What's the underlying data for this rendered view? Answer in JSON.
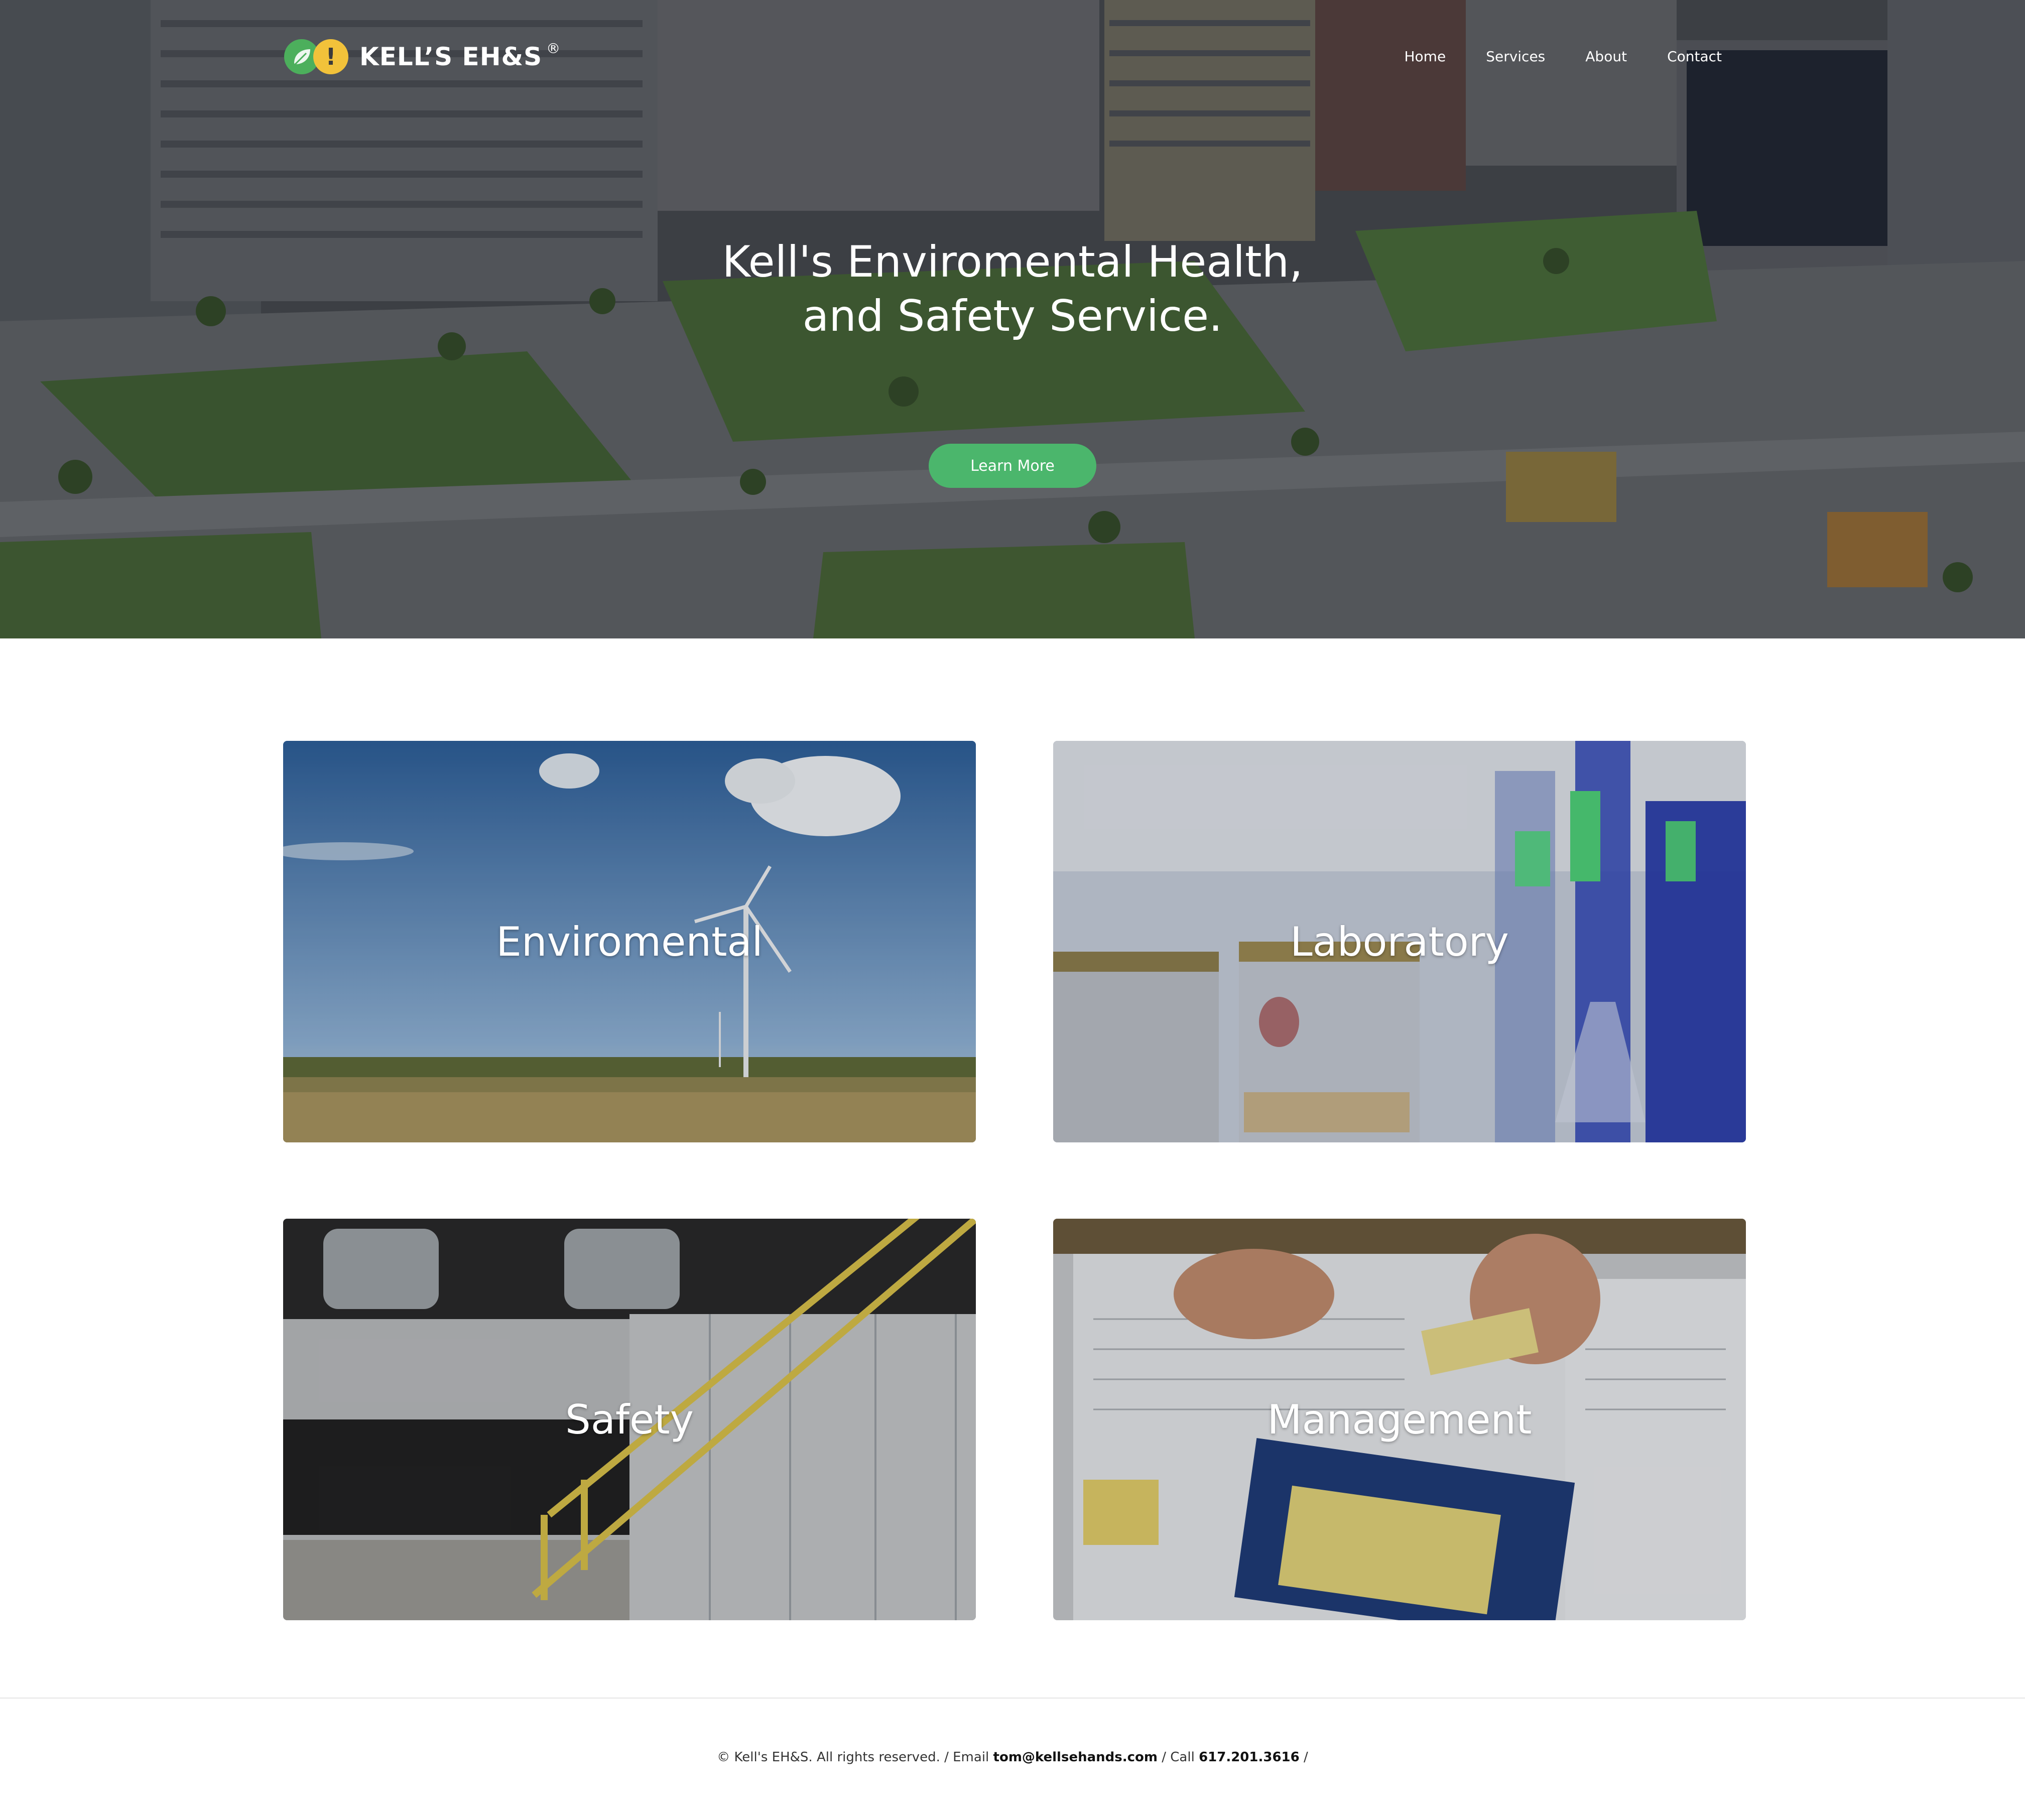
{
  "header": {
    "logo_text": "KELL’S EH&S",
    "logo_reg": "®",
    "logo_excl": "!",
    "nav": [
      "Home",
      "Services",
      "About",
      "Contact"
    ]
  },
  "hero": {
    "title_line1": "Kell's Enviromental Health,",
    "title_line2": "and Safety Service.",
    "cta_label": "Learn More"
  },
  "services": [
    "Enviromental",
    "Laboratory",
    "Safety",
    "Management"
  ],
  "footer": {
    "copyright": "© Kell's EH&S. All rights reserved. / Email ",
    "email": "tom@kellsehands.com",
    "call_prefix": " / Call ",
    "phone": "617.201.3616",
    "trail": " /"
  },
  "colors": {
    "brand_green": "#4bb66c",
    "logo_green": "#4caf5c",
    "logo_yellow": "#f2c23a"
  }
}
